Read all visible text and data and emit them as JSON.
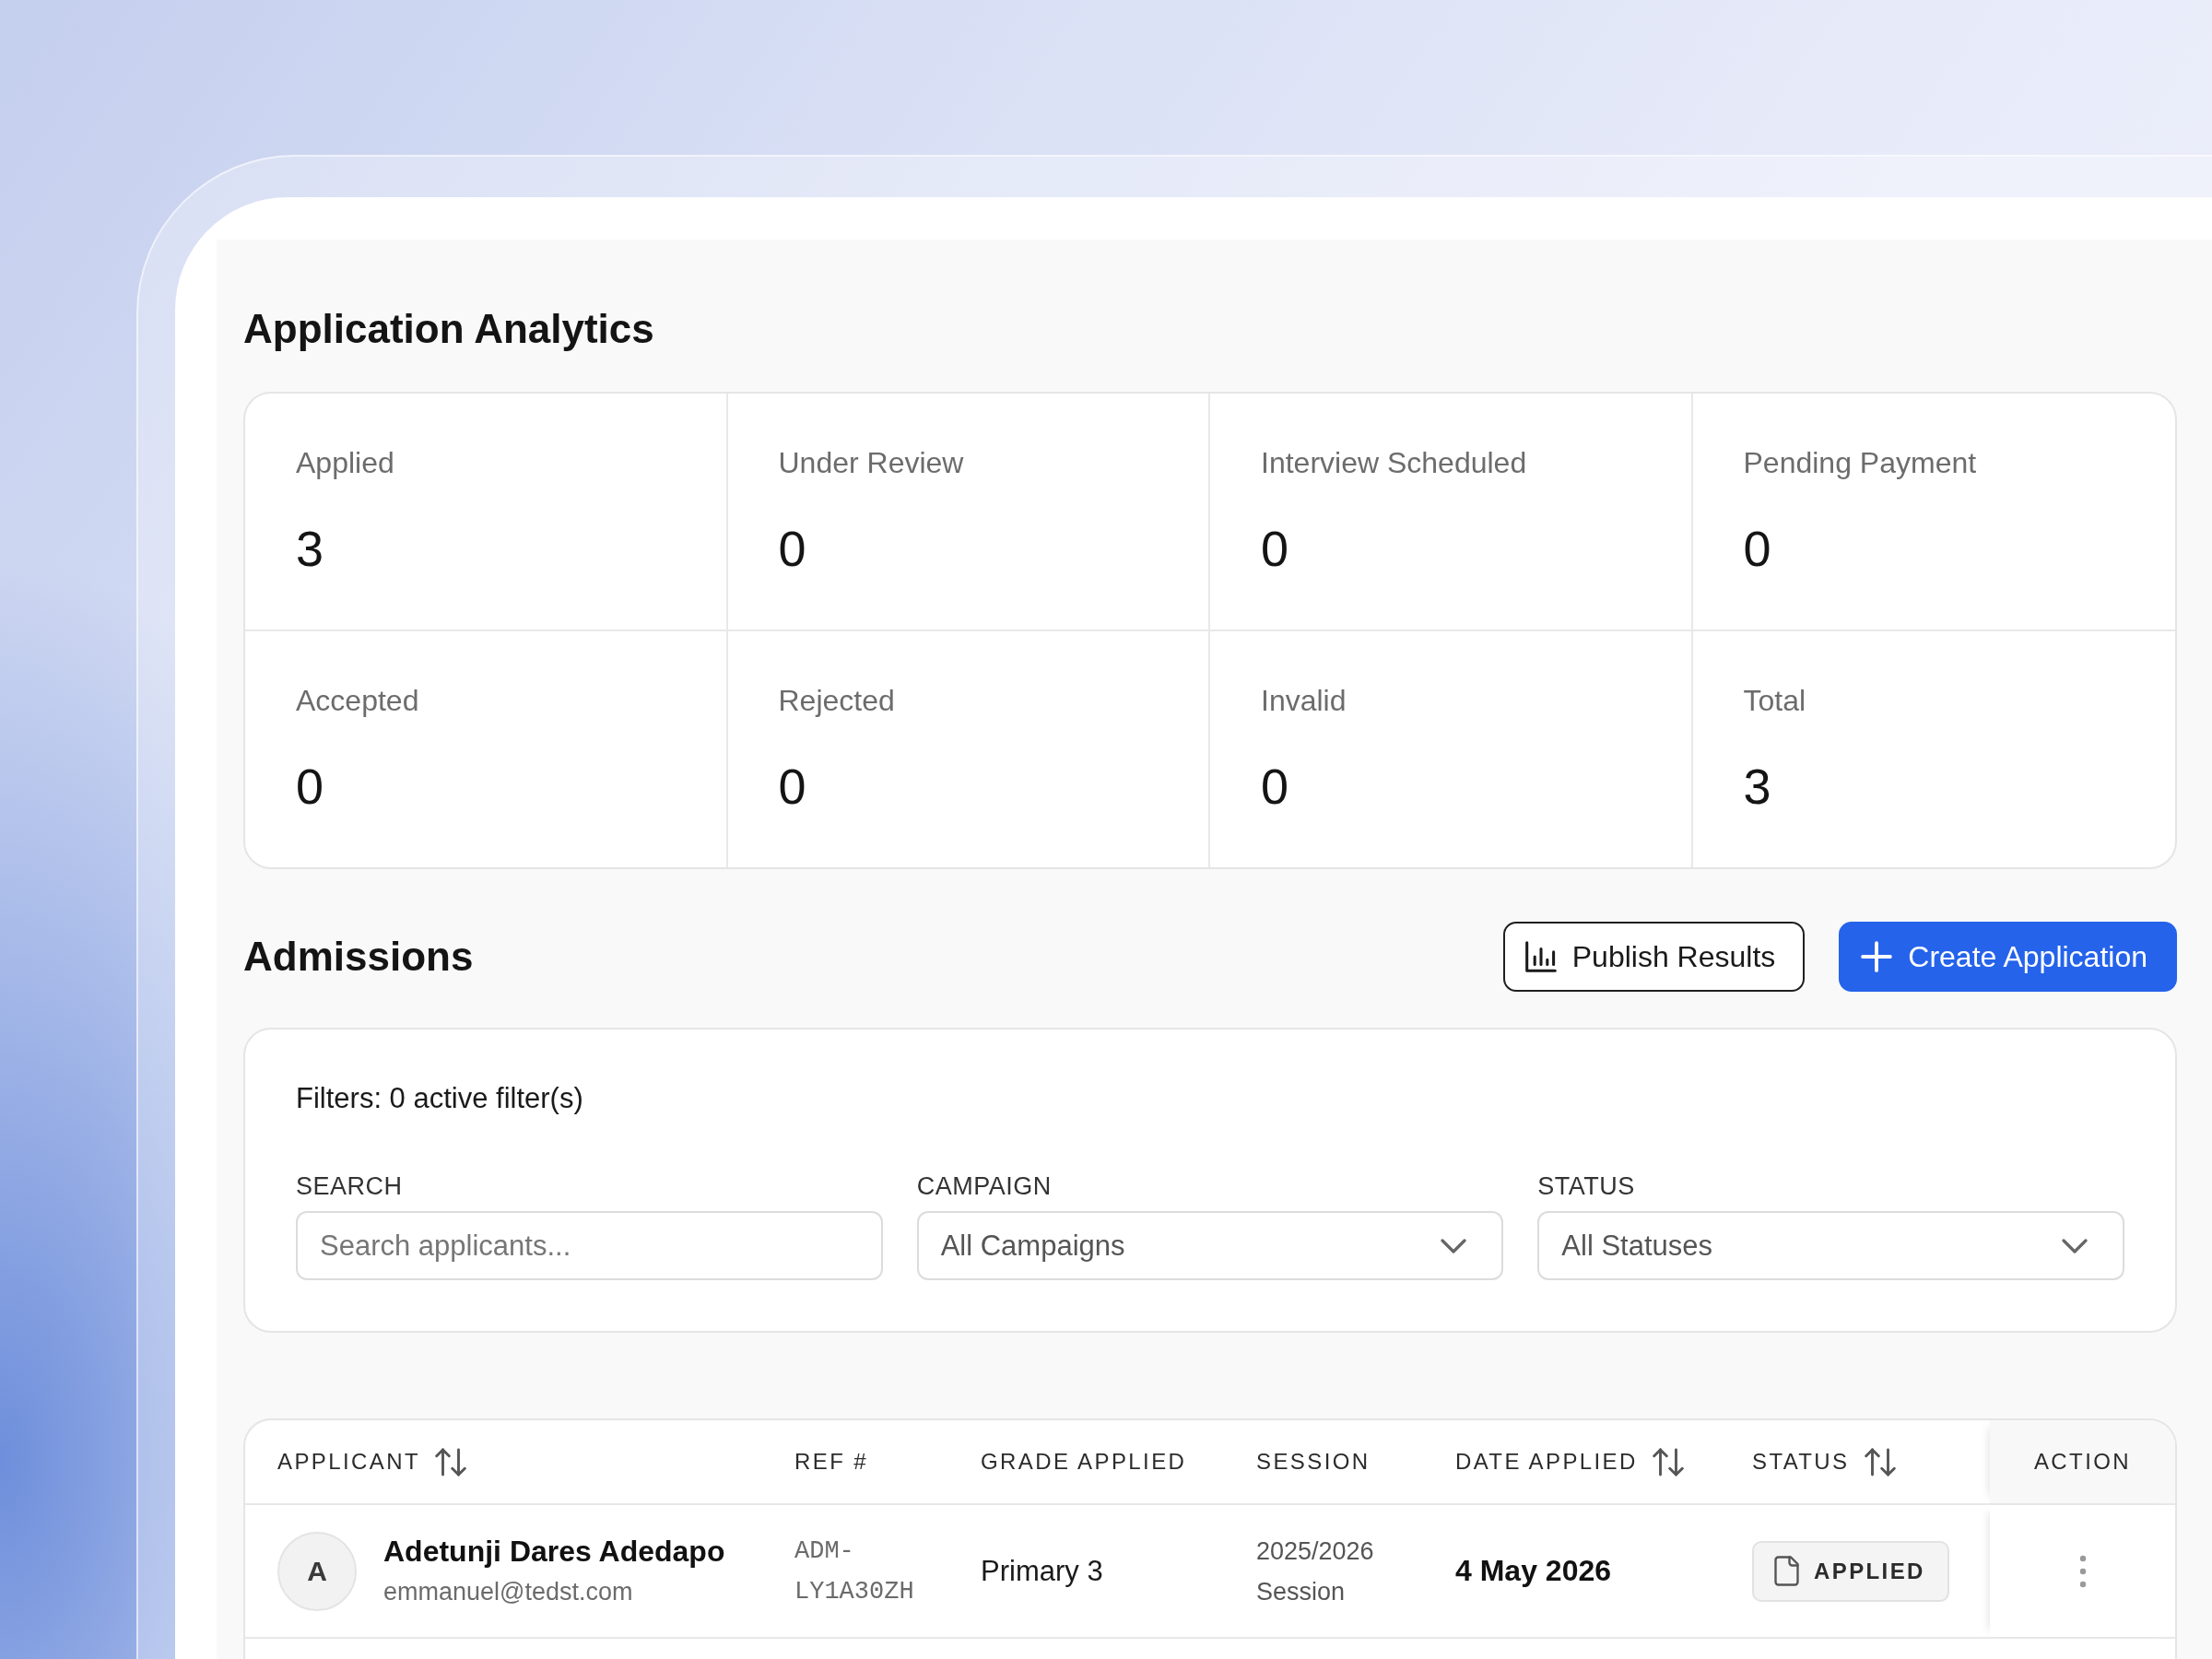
{
  "analytics": {
    "title": "Application Analytics",
    "stats": [
      {
        "label": "Applied",
        "value": "3"
      },
      {
        "label": "Under Review",
        "value": "0"
      },
      {
        "label": "Interview Scheduled",
        "value": "0"
      },
      {
        "label": "Pending Payment",
        "value": "0"
      },
      {
        "label": "Accepted",
        "value": "0"
      },
      {
        "label": "Rejected",
        "value": "0"
      },
      {
        "label": "Invalid",
        "value": "0"
      },
      {
        "label": "Total",
        "value": "3"
      }
    ]
  },
  "admissions": {
    "title": "Admissions",
    "actions": [
      {
        "label": "Publish Results",
        "kind": "outline"
      },
      {
        "label": "Create Application",
        "kind": "primary"
      }
    ]
  },
  "filters": {
    "summary": "Filters: 0 active filter(s)",
    "fields": [
      {
        "label": "SEARCH",
        "kind": "text",
        "placeholder": "Search applicants..."
      },
      {
        "label": "CAMPAIGN",
        "kind": "select",
        "value": "All Campaigns"
      },
      {
        "label": "STATUS",
        "kind": "select",
        "value": "All Statuses"
      }
    ]
  },
  "table": {
    "columns": [
      {
        "label": "APPLICANT",
        "sortable": true
      },
      {
        "label": "REF #",
        "sortable": false
      },
      {
        "label": "GRADE APPLIED",
        "sortable": false
      },
      {
        "label": "SESSION",
        "sortable": false
      },
      {
        "label": "DATE APPLIED",
        "sortable": true
      },
      {
        "label": "STATUS",
        "sortable": true
      },
      {
        "label": "ACTION",
        "sortable": false
      }
    ],
    "rows": [
      {
        "initial": "A",
        "name": "Adetunji Dares Adedapo",
        "email": "emmanuel@tedst.com",
        "ref": "ADM-LY1A30ZH",
        "grade": "Primary 3",
        "session": "2025/2026 Session",
        "date": "4 May 2026",
        "status": "APPLIED"
      }
    ]
  }
}
